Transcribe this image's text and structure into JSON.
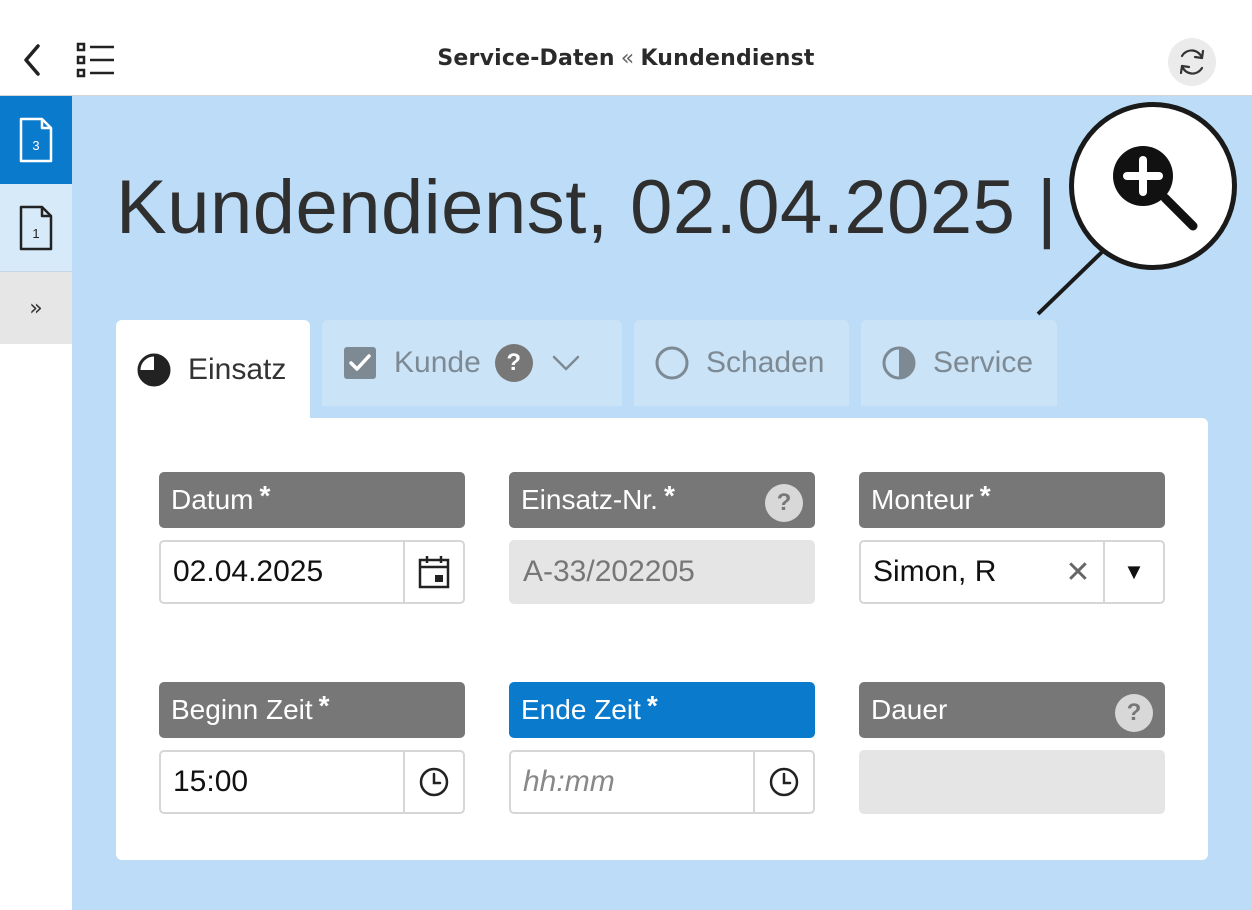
{
  "header": {
    "breadcrumb_current": "Service-Daten",
    "breadcrumb_separator": "«",
    "breadcrumb_parent": "Kundendienst",
    "back_icon": "chevron-left-icon",
    "menu_icon": "list-icon",
    "sync_icon": "refresh-icon"
  },
  "sidebar": {
    "items": [
      {
        "label": "3",
        "icon": "document-icon",
        "active": true
      },
      {
        "label": "1",
        "icon": "document-icon",
        "active": false
      },
      {
        "label": "»",
        "icon": "double-chevron-right-icon",
        "active": false
      }
    ]
  },
  "page": {
    "title": "Kundendienst, 02.04.2025 |"
  },
  "tabs": [
    {
      "label": "Einsatz",
      "icon": "three-quarter-circle-icon",
      "active": true
    },
    {
      "label": "Kunde",
      "icon": "checked-checkbox-icon",
      "help": "?",
      "dropdown": true,
      "active": false
    },
    {
      "label": "Schaden",
      "icon": "empty-circle-icon",
      "active": false
    },
    {
      "label": "Service",
      "icon": "half-circle-icon",
      "active": false
    }
  ],
  "form": {
    "datum": {
      "label": "Datum",
      "required": "*",
      "value": "02.04.2025",
      "icon": "calendar-icon"
    },
    "einsatz_nr": {
      "label": "Einsatz-Nr.",
      "required": "*",
      "value": "A-33/202205",
      "help": "?"
    },
    "monteur": {
      "label": "Monteur",
      "required": "*",
      "value": "Simon, R",
      "clear": "✕",
      "dropdown": "▼"
    },
    "beginn_zeit": {
      "label": "Beginn Zeit",
      "required": "*",
      "value": "15:00",
      "icon": "clock-icon"
    },
    "ende_zeit": {
      "label": "Ende Zeit",
      "required": "*",
      "placeholder": "hh:mm",
      "icon": "clock-icon"
    },
    "dauer": {
      "label": "Dauer",
      "value": "",
      "help": "?"
    }
  },
  "zoom": {
    "icon": "zoom-in-icon"
  },
  "colors": {
    "accent": "#0a7acc",
    "main_bg": "#bcdcf7",
    "label_bg": "#777777",
    "inactive_tab": "#cbe3f6"
  }
}
